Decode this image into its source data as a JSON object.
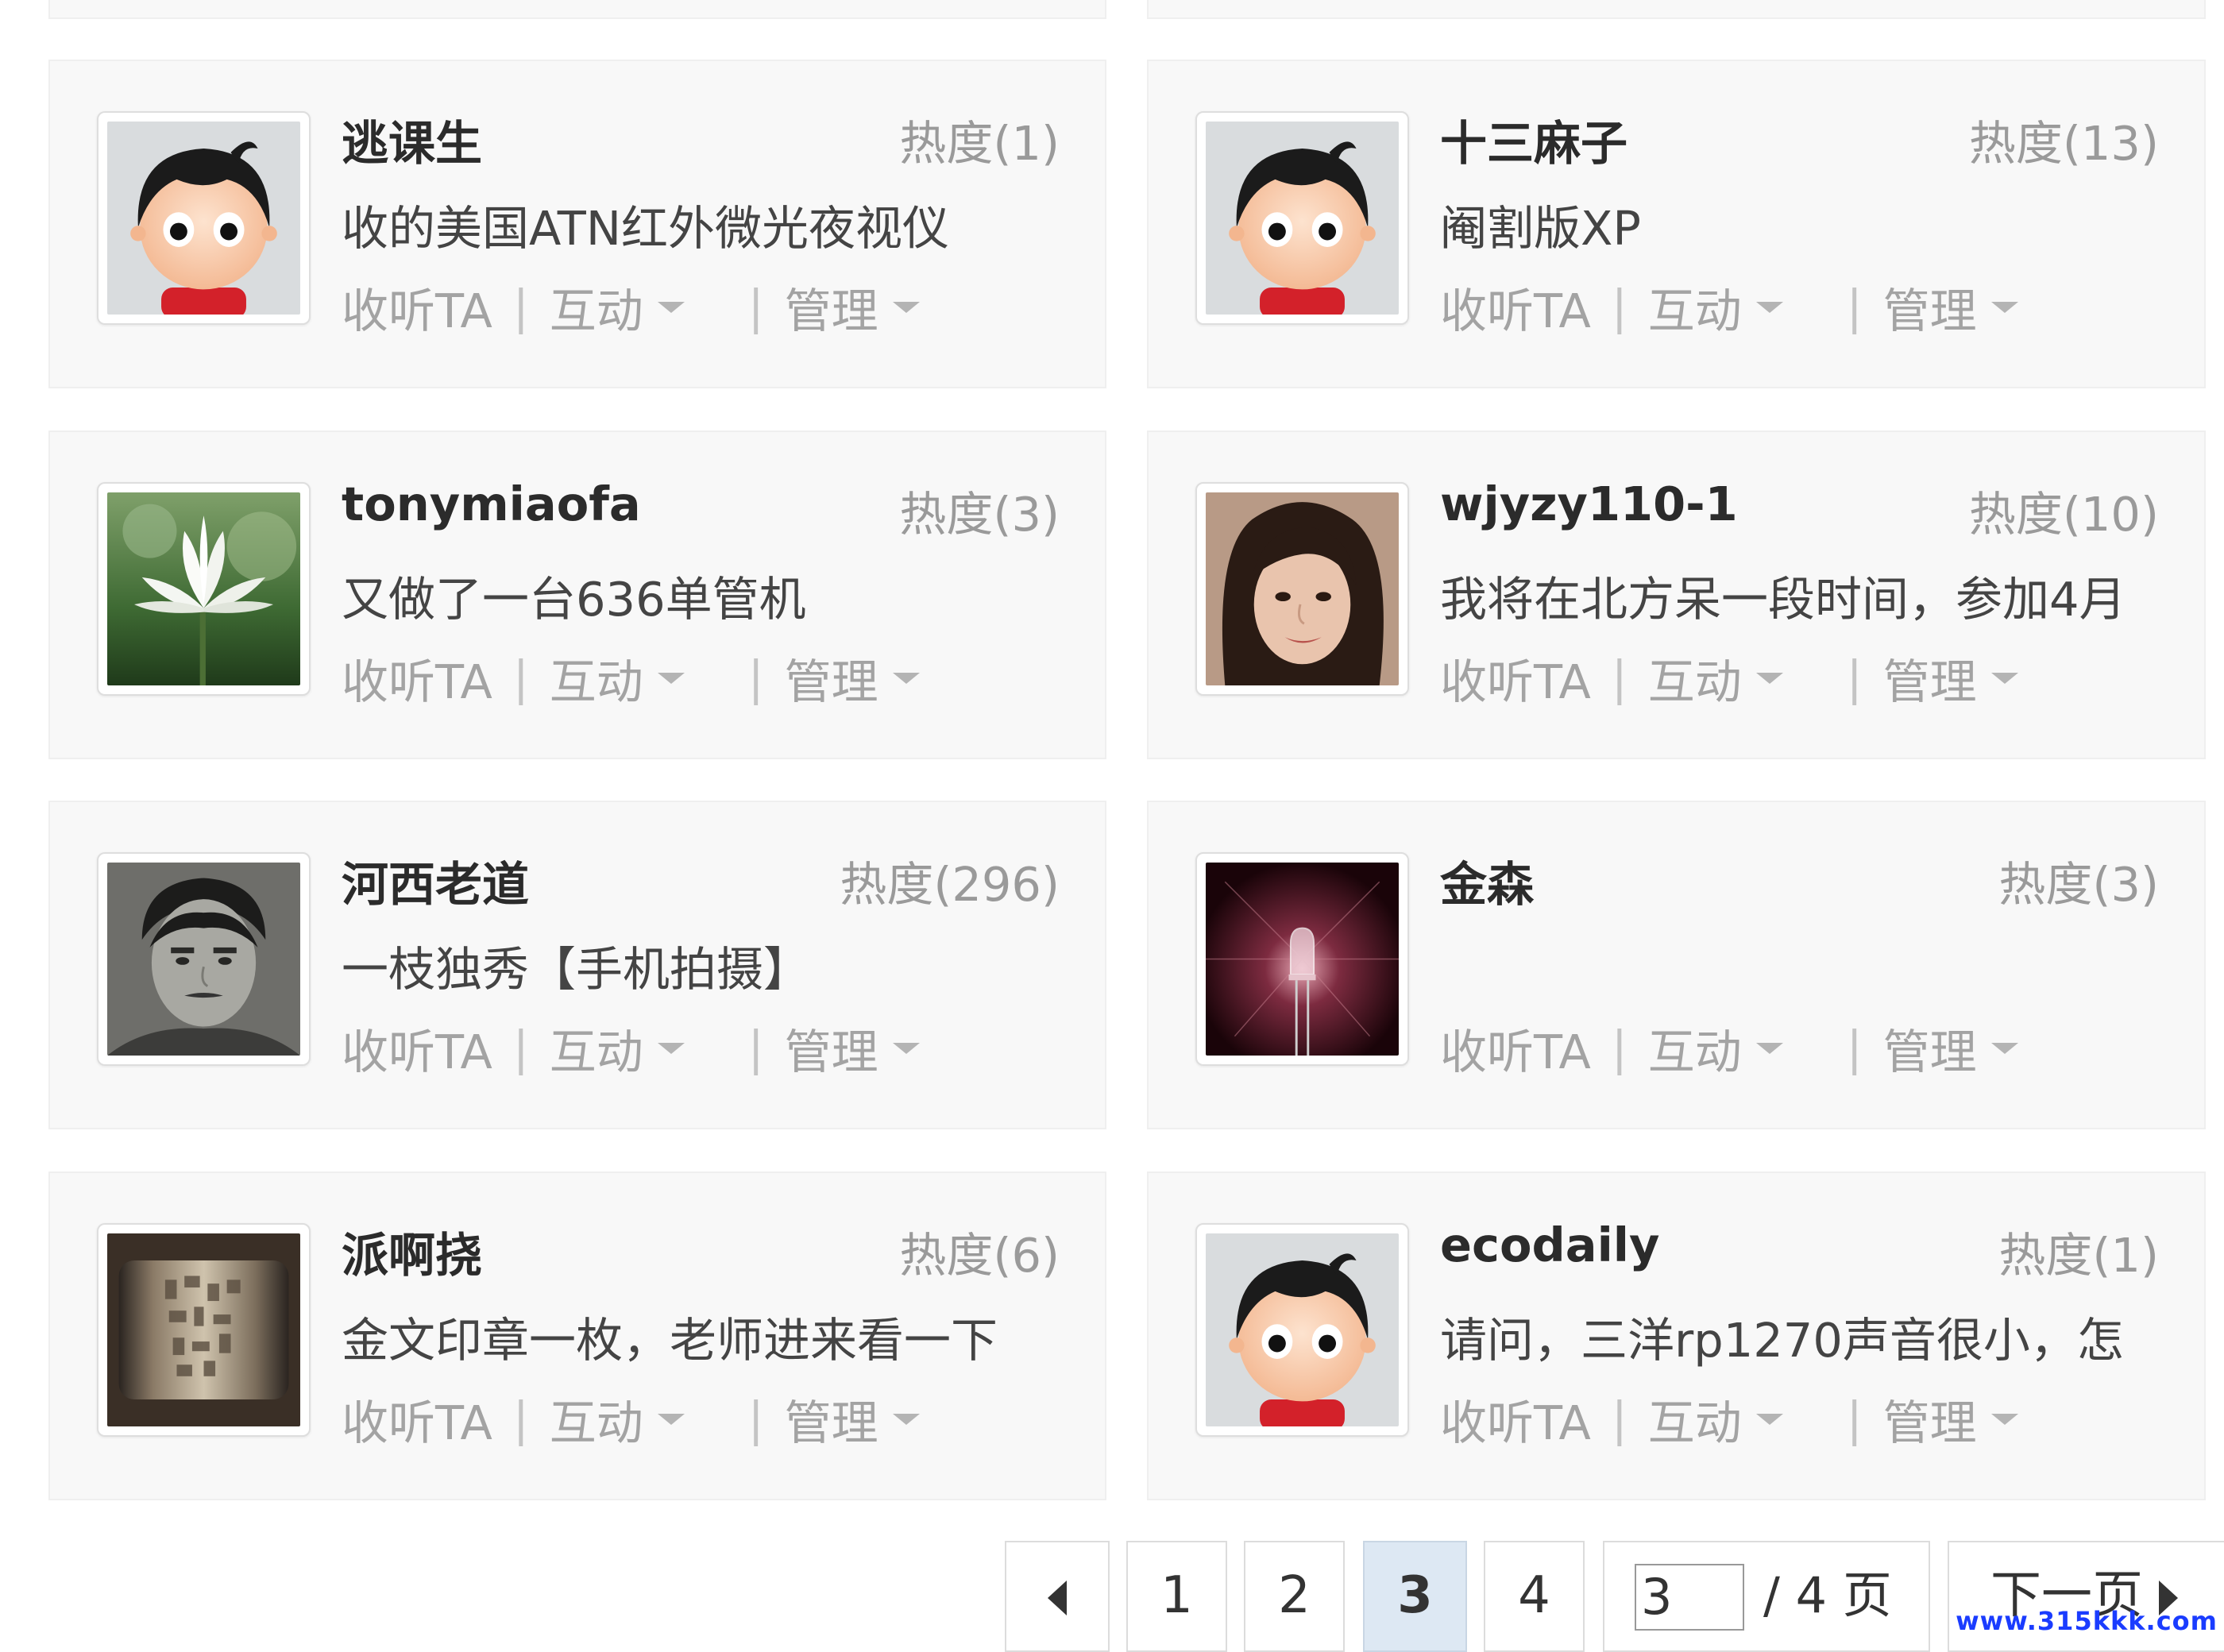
{
  "labels": {
    "follow": "收听TA",
    "interact": "互动",
    "manage": "管理",
    "separator": "|"
  },
  "users": [
    {
      "name": "逃课生",
      "heat": "热度(1)",
      "desc": "收的美国ATN红外微光夜视仪",
      "avatar": "default-avatar"
    },
    {
      "name": "十三麻子",
      "heat": "热度(13)",
      "desc": "阉割版XP",
      "avatar": "default-avatar"
    },
    {
      "name": "tonymiaofa",
      "heat": "热度(3)",
      "desc": "又做了一台636单管机",
      "avatar": "white-lotus-photo"
    },
    {
      "name": "wjyzy110-1",
      "heat": "热度(10)",
      "desc": "我将在北方呆一段时间，参加4月",
      "avatar": "woman-portrait-photo"
    },
    {
      "name": "河西老道",
      "heat": "热度(296)",
      "desc": "一枝独秀【手机拍摄】",
      "avatar": "man-portrait-photo"
    },
    {
      "name": "金森",
      "heat": "热度(3)",
      "desc": "",
      "avatar": "led-bulb-photo"
    },
    {
      "name": "派啊挠",
      "heat": "热度(6)",
      "desc": "金文印章一枚，老师进来看一下",
      "avatar": "bronze-seal-photo"
    },
    {
      "name": "ecodaily",
      "heat": "热度(1)",
      "desc": "请问，三洋rp1270声音很小，怎",
      "avatar": "default-avatar"
    }
  ],
  "pagination": {
    "prev_icon": "arrow-left-icon",
    "pages": [
      "1",
      "2",
      "3",
      "4"
    ],
    "current": "3",
    "input_value": "3",
    "total_text": "/ 4 页",
    "next_label": "下一页",
    "next_icon": "arrow-right-icon"
  },
  "watermark": "www.315kkk.com",
  "colors": {
    "card_bg": "#f8f8f8",
    "name": "#2b2b2b",
    "muted": "#a3a3a3",
    "active_page_bg": "#dde8f3",
    "watermark": "#1a3cff"
  }
}
